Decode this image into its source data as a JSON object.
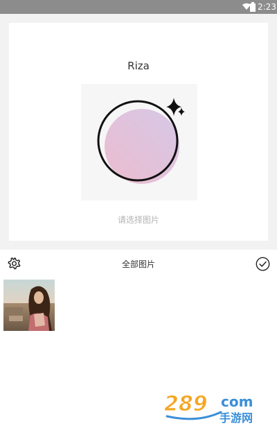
{
  "status_bar": {
    "time": "2:23",
    "icons": [
      "wifi-icon",
      "battery-icon"
    ]
  },
  "card": {
    "title": "Riza",
    "hint": "请选择图片"
  },
  "toolbar": {
    "album": "全部图片",
    "left_icon": "gear-icon",
    "right_icon": "check-circle-icon"
  },
  "photos": [
    {
      "name": "photo-thumbnail"
    }
  ],
  "watermark": {
    "number": "289",
    "domain": "com",
    "site": "手游网"
  },
  "colors": {
    "accent_pink": "#e6c3dc",
    "status_bar": "#8c8c8c",
    "watermark_orange": "#f5a623",
    "watermark_blue": "#3a8fd8"
  }
}
